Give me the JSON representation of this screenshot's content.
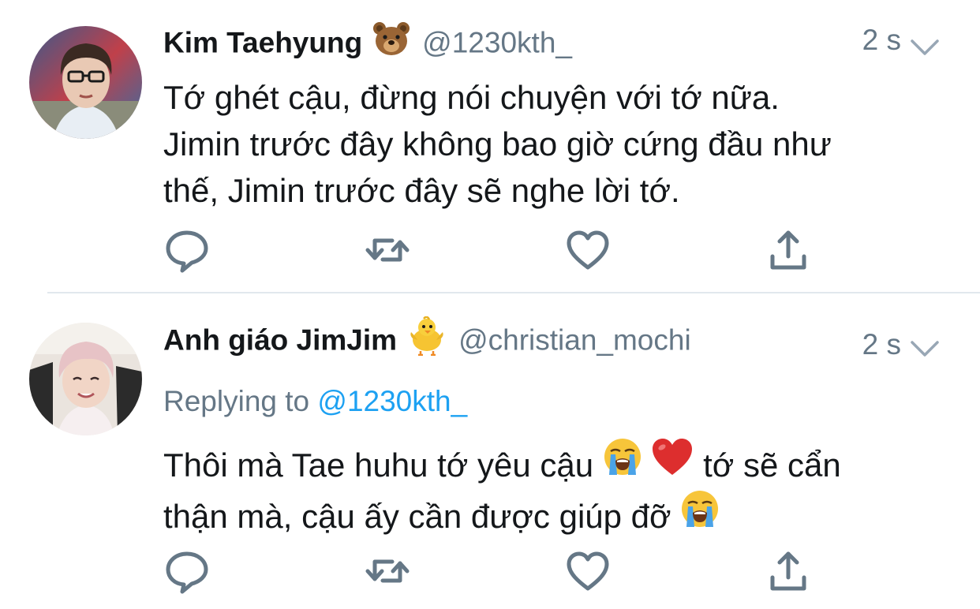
{
  "colors": {
    "text_primary": "#14171a",
    "text_secondary": "#657786",
    "link": "#1da1f2",
    "icon": "#657786",
    "divider": "#e1e8ed"
  },
  "tweets": [
    {
      "display_name": "Kim Taehyung",
      "name_emoji": "bear-face",
      "handle": "@1230kth_",
      "time": "2 s",
      "lines": [
        "Tớ ghét cậu, đừng nói chuyện với tớ nữa.",
        "Jimin trước đây không bao giờ cứng đầu như",
        "thế, Jimin trước đây sẽ nghe lời tớ."
      ],
      "actions": [
        "reply-icon",
        "retweet-icon",
        "like-icon",
        "share-icon"
      ]
    },
    {
      "display_name": "Anh giáo JimJim",
      "name_emoji": "baby-chick",
      "handle": "@christian_mochi",
      "time": "2 s",
      "replying_prefix": "Replying to",
      "replying_handle": "@1230kth_",
      "line1_a": "Thôi mà Tae huhu tớ yêu cậu",
      "line1_b": "tớ sẽ cẩn",
      "line2_a": "thận mà, cậu ấy cần được giúp đỡ",
      "inline_emojis": [
        "loudly-crying-face",
        "red-heart",
        "loudly-crying-face"
      ],
      "actions": [
        "reply-icon",
        "retweet-icon",
        "like-icon",
        "share-icon"
      ]
    }
  ]
}
